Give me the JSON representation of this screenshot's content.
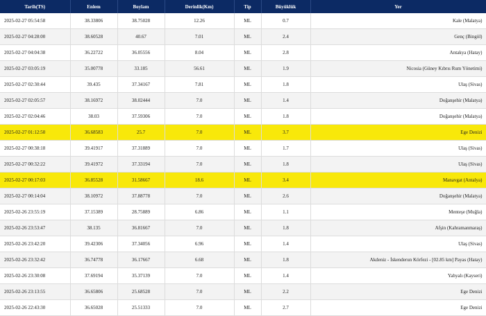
{
  "columns": [
    "Tarih(TS)",
    "Enlem",
    "Boylam",
    "Derinlik(Km)",
    "Tip",
    "Büyüklük",
    "Yer"
  ],
  "highlight_color": "#f8e80a",
  "header_color": "#0c2a64",
  "rows": [
    {
      "time": "2025-02-27 05:54:58",
      "lat": "38.33806",
      "lon": "38.75028",
      "depth": "12.26",
      "type": "ML",
      "mag": "0.7",
      "loc": "Kale (Malatya)",
      "hl": false
    },
    {
      "time": "2025-02-27 04:28:00",
      "lat": "38.60528",
      "lon": "40.67",
      "depth": "7.01",
      "type": "ML",
      "mag": "2.4",
      "loc": "Genç (Bingöl)",
      "hl": false
    },
    {
      "time": "2025-02-27 04:04:38",
      "lat": "36.22722",
      "lon": "36.05556",
      "depth": "8.04",
      "type": "ML",
      "mag": "2.8",
      "loc": "Antakya (Hatay)",
      "hl": false
    },
    {
      "time": "2025-02-27 03:05:19",
      "lat": "35.00778",
      "lon": "33.185",
      "depth": "56.61",
      "type": "ML",
      "mag": "1.9",
      "loc": "Nicosia (Güney Kıbrıs Rum Yönetimi)",
      "hl": false
    },
    {
      "time": "2025-02-27 02:30:44",
      "lat": "39.435",
      "lon": "37.34167",
      "depth": "7.81",
      "type": "ML",
      "mag": "1.8",
      "loc": "Ulaş (Sivas)",
      "hl": false
    },
    {
      "time": "2025-02-27 02:05:57",
      "lat": "38.16972",
      "lon": "38.02444",
      "depth": "7.0",
      "type": "ML",
      "mag": "1.4",
      "loc": "Doğanşehir (Malatya)",
      "hl": false
    },
    {
      "time": "2025-02-27 02:04:46",
      "lat": "38.03",
      "lon": "37.59306",
      "depth": "7.0",
      "type": "ML",
      "mag": "1.8",
      "loc": "Doğanşehir (Malatya)",
      "hl": false
    },
    {
      "time": "2025-02-27 01:12:50",
      "lat": "36.68583",
      "lon": "25.7",
      "depth": "7.0",
      "type": "ML",
      "mag": "3.7",
      "loc": "Ege Denizi",
      "hl": true
    },
    {
      "time": "2025-02-27 00:38:18",
      "lat": "39.41917",
      "lon": "37.31889",
      "depth": "7.0",
      "type": "ML",
      "mag": "1.7",
      "loc": "Ulaş (Sivas)",
      "hl": false
    },
    {
      "time": "2025-02-27 00:32:22",
      "lat": "39.41972",
      "lon": "37.33194",
      "depth": "7.0",
      "type": "ML",
      "mag": "1.8",
      "loc": "Ulaş (Sivas)",
      "hl": false
    },
    {
      "time": "2025-02-27 00:17:03",
      "lat": "36.85528",
      "lon": "31.58667",
      "depth": "18.6",
      "type": "ML",
      "mag": "3.4",
      "loc": "Manavgat (Antalya)",
      "hl": true
    },
    {
      "time": "2025-02-27 00:14:04",
      "lat": "38.10972",
      "lon": "37.88778",
      "depth": "7.0",
      "type": "ML",
      "mag": "2.6",
      "loc": "Doğanşehir (Malatya)",
      "hl": false
    },
    {
      "time": "2025-02-26 23:55:19",
      "lat": "37.15389",
      "lon": "28.75889",
      "depth": "6.86",
      "type": "ML",
      "mag": "1.1",
      "loc": "Menteşe (Muğla)",
      "hl": false
    },
    {
      "time": "2025-02-26 23:53:47",
      "lat": "38.135",
      "lon": "36.81667",
      "depth": "7.0",
      "type": "ML",
      "mag": "1.8",
      "loc": "Afşin (Kahramanmaraş)",
      "hl": false
    },
    {
      "time": "2025-02-26 23:42:20",
      "lat": "39.42306",
      "lon": "37.34056",
      "depth": "6.96",
      "type": "ML",
      "mag": "1.4",
      "loc": "Ulaş (Sivas)",
      "hl": false
    },
    {
      "time": "2025-02-26 23:32:42",
      "lat": "36.74778",
      "lon": "36.17667",
      "depth": "6.68",
      "type": "ML",
      "mag": "1.8",
      "loc": "Akdeniz - İskenderun Körfezi - [02.85 km] Payas (Hatay)",
      "hl": false
    },
    {
      "time": "2025-02-26 23:30:08",
      "lat": "37.69194",
      "lon": "35.37139",
      "depth": "7.0",
      "type": "ML",
      "mag": "1.4",
      "loc": "Yahyalı (Kayseri)",
      "hl": false
    },
    {
      "time": "2025-02-26 23:13:55",
      "lat": "36.65806",
      "lon": "25.68528",
      "depth": "7.0",
      "type": "ML",
      "mag": "2.2",
      "loc": "Ege Denizi",
      "hl": false
    },
    {
      "time": "2025-02-26 22:43:30",
      "lat": "36.65028",
      "lon": "25.51333",
      "depth": "7.0",
      "type": "ML",
      "mag": "2.7",
      "loc": "Ege Denizi",
      "hl": false
    }
  ]
}
